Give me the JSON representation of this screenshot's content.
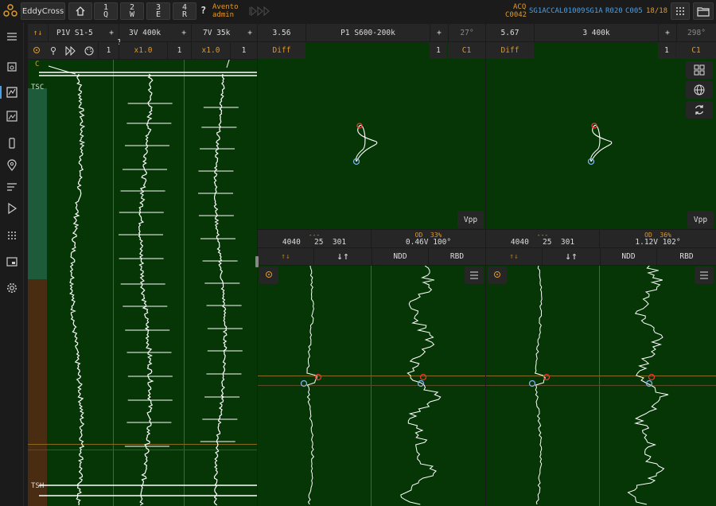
{
  "app": {
    "name": "EddyCross",
    "user_name": "Avento",
    "user_role": "admin"
  },
  "toolbar": {
    "keys": [
      {
        "num": "1",
        "letter": "Q"
      },
      {
        "num": "2",
        "letter": "W"
      },
      {
        "num": "3",
        "letter": "E"
      },
      {
        "num": "4",
        "letter": "R"
      }
    ],
    "help_label": "?"
  },
  "status": {
    "mode": "ACQ",
    "code": "C0042",
    "tube_id": "SG1ACCAL01009",
    "sg": "SG1A",
    "row": "R020",
    "col": "C005",
    "count": "18/18"
  },
  "strips": [
    {
      "channel": "P1V S1-5",
      "scale": "x1.0",
      "index": "1"
    },
    {
      "channel": "3V 400k",
      "scale": "x1.0",
      "index": "1"
    },
    {
      "channel": "7V  35k",
      "scale": "x1.0",
      "index": "1"
    }
  ],
  "strip_tools": {
    "plus": "+",
    "c_label": "C"
  },
  "strip_markers": {
    "top": "TSC",
    "bottom": "TSH"
  },
  "lissajous": [
    {
      "value": "3.56",
      "channel": "P1 S600-200k",
      "angle": "27°",
      "mode": "Diff",
      "index": "1",
      "cursor": "C1",
      "vpp": "Vpp",
      "meas_line1": "---",
      "meas_a": "4040",
      "meas_b": "25",
      "meas_c": "301",
      "od": "OD",
      "od_pct": "33%",
      "volt": "0.46V 100°",
      "ndd": "NDD",
      "rbd": "RBD"
    },
    {
      "value": "5.67",
      "channel": "3 400k",
      "angle": "298°",
      "mode": "Diff",
      "index": "1",
      "cursor": "C1",
      "vpp": "Vpp",
      "meas_line1": "---",
      "meas_a": "4040",
      "meas_b": "25",
      "meas_c": "301",
      "od": "OD",
      "od_pct": "36%",
      "volt": "1.12V 102°",
      "ndd": "NDD",
      "rbd": "RBD"
    }
  ],
  "colors": {
    "plot_bg": "#063606",
    "trace": "#ffffff",
    "accent": "#e09a2a",
    "info": "#4aa0e6",
    "marker_red": "#e53935",
    "marker_blue": "#7fb3e8"
  }
}
